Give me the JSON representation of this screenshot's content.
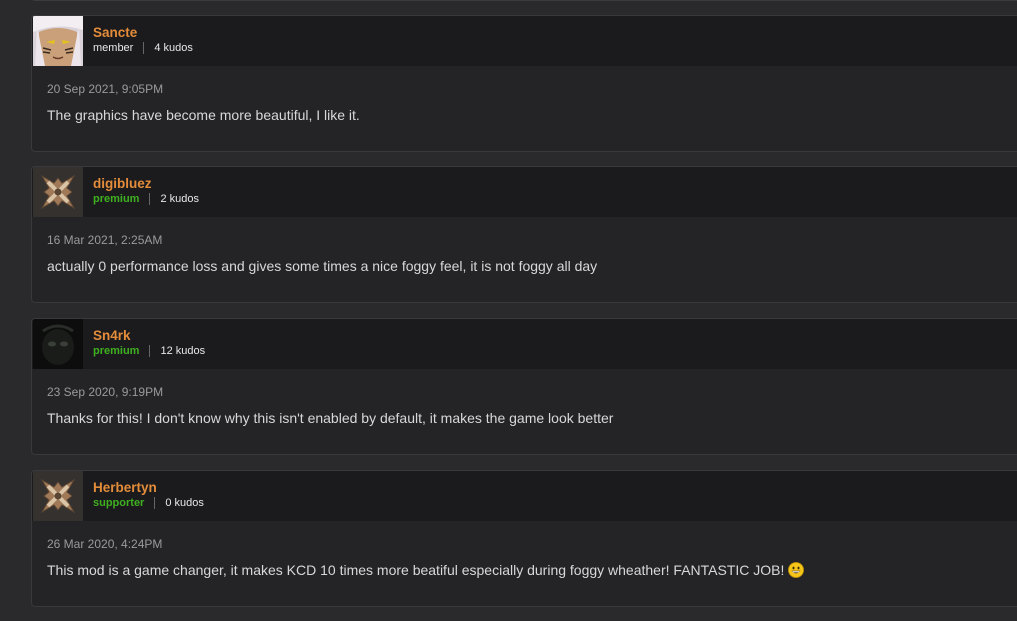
{
  "comments": [
    {
      "username": "Sancte",
      "role": "member",
      "kudos": "4 kudos",
      "date": "20 Sep 2021, 9:05PM",
      "text": "The graphics have become more beautiful, I like it."
    },
    {
      "username": "digibluez",
      "role": "premium",
      "kudos": "2 kudos",
      "date": "16 Mar 2021, 2:25AM",
      "text": "actually 0 performance loss and  gives some times a nice foggy feel, it is not foggy all day"
    },
    {
      "username": "Sn4rk",
      "role": "premium",
      "kudos": "12 kudos",
      "date": "23 Sep 2020, 9:19PM",
      "text": "Thanks for this! I don't know why this isn't enabled by default, it makes the game look better"
    },
    {
      "username": "Herbertyn",
      "role": "supporter",
      "kudos": "0 kudos",
      "date": "26 Mar 2020, 4:24PM",
      "text": "This mod is a game changer, it makes KCD 10 times more beatiful especially during foggy wheather! FANTASTIC JOB!",
      "emoji": "grinning-face-emoji"
    }
  ],
  "colors": {
    "username": "#e38c3a",
    "role_premium": "#3fb020",
    "background": "#2a2a2c",
    "card": "#242427",
    "header": "#1b1b1d"
  }
}
